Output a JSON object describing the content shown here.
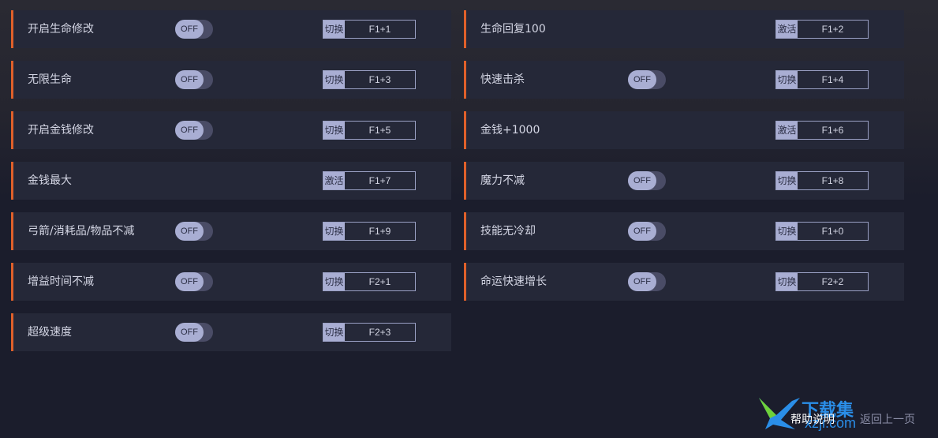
{
  "cheats": [
    {
      "label": "开启生命修改",
      "toggle": "OFF",
      "mode": "切换",
      "key": "F1+1"
    },
    {
      "label": "生命回复100",
      "toggle": null,
      "mode": "激活",
      "key": "F1+2"
    },
    {
      "label": "无限生命",
      "toggle": "OFF",
      "mode": "切换",
      "key": "F1+3"
    },
    {
      "label": "快速击杀",
      "toggle": "OFF",
      "mode": "切换",
      "key": "F1+4"
    },
    {
      "label": "开启金钱修改",
      "toggle": "OFF",
      "mode": "切换",
      "key": "F1+5"
    },
    {
      "label": "金钱+1000",
      "toggle": null,
      "mode": "激活",
      "key": "F1+6"
    },
    {
      "label": "金钱最大",
      "toggle": null,
      "mode": "激活",
      "key": "F1+7"
    },
    {
      "label": "魔力不减",
      "toggle": "OFF",
      "mode": "切换",
      "key": "F1+8"
    },
    {
      "label": "弓箭/消耗品/物品不减",
      "toggle": "OFF",
      "mode": "切换",
      "key": "F1+9"
    },
    {
      "label": "技能无冷却",
      "toggle": "OFF",
      "mode": "切换",
      "key": "F1+0"
    },
    {
      "label": "增益时间不减",
      "toggle": "OFF",
      "mode": "切换",
      "key": "F2+1"
    },
    {
      "label": "命运快速增长",
      "toggle": "OFF",
      "mode": "切换",
      "key": "F2+2"
    },
    {
      "label": "超级速度",
      "toggle": "OFF",
      "mode": "切换",
      "key": "F2+3"
    }
  ],
  "footer": {
    "brand": "下载集",
    "domain": "xzji.com",
    "help_label": "帮助说明",
    "back_label": "返回上一页"
  },
  "colors": {
    "accent": "#e0602a",
    "row_bg": "#252838",
    "page_bg": "#1b1d2c",
    "toggle_knob": "#a9aed3",
    "logo": "#2a8ee8"
  }
}
